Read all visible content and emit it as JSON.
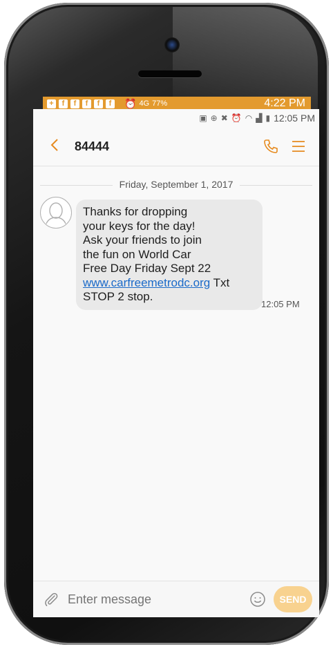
{
  "back_status": {
    "network": "4G",
    "battery": "77%",
    "time": "4:22 PM"
  },
  "status": {
    "time": "12:05 PM"
  },
  "header": {
    "title": "84444"
  },
  "conversation": {
    "date": "Friday, September 1, 2017",
    "messages": [
      {
        "lines": [
          "Thanks for dropping",
          "your keys for the day!",
          "Ask your friends to join",
          "the fun on World Car",
          "Free Day Friday Sept 22"
        ],
        "link": "www.carfreemetrodc.org",
        "after_link": " Txt",
        "last_line": "STOP 2 stop.",
        "time": "12:05 PM"
      }
    ]
  },
  "composer": {
    "placeholder": "Enter message",
    "send_label": "SEND"
  },
  "colors": {
    "accent": "#e68a1e",
    "link": "#1a6ac9",
    "bubble": "#e9e9e9",
    "send_disabled": "#f8d28f"
  }
}
